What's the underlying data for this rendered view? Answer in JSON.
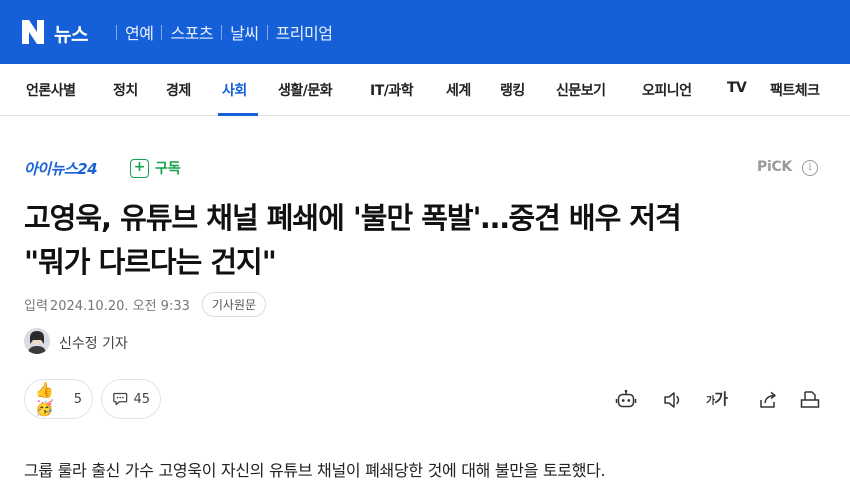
{
  "header": {
    "brand": "뉴스",
    "links": [
      "연예",
      "스포츠",
      "날씨",
      "프리미엄"
    ]
  },
  "categories": [
    "언론사별",
    "정치",
    "경제",
    "사회",
    "생활/문화",
    "IT/과학",
    "세계",
    "랭킹",
    "신문보기",
    "오피니언",
    "TV",
    "팩트체크"
  ],
  "active_category": "사회",
  "press": {
    "name": "아이뉴스24",
    "subscribe_label": "구독",
    "pick_label": "PiCK",
    "pick_info": "i"
  },
  "article": {
    "headline_line1": "고영욱, 유튜브 채널 폐쇄에 '불만 폭발'…중견 배우 저격",
    "headline_line2": "\"뭐가 다르다는 건지\"",
    "date_label": "입력",
    "date": "2024.10.20. 오전 9:33",
    "original_label": "기사원문",
    "reporter": "신수정 기자",
    "first_paragraph": "그룹 룰라 출신 가수 고영욱이 자신의 유튜브 채널이 폐쇄당한 것에 대해 불만을 토로했다."
  },
  "reactions": {
    "emoji_count": "5",
    "comment_count": "45"
  },
  "tools": {
    "font_size_small": "가",
    "font_size_big": "가"
  },
  "colors": {
    "brand_blue": "#1560d8",
    "subscribe_green": "#16a34a"
  }
}
